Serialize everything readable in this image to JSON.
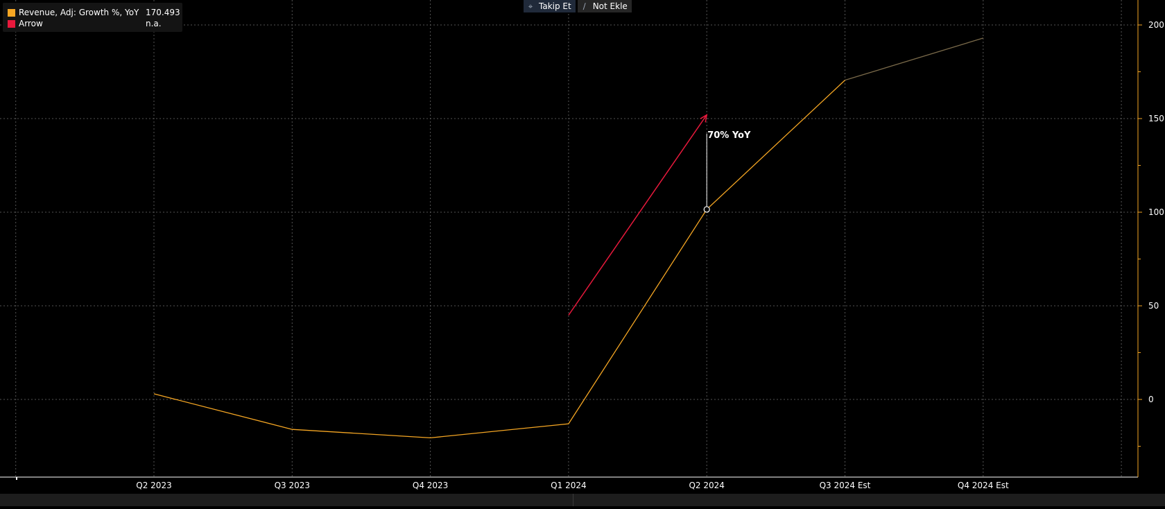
{
  "toolbar": {
    "follow_label": "Takip Et",
    "note_label": "Not Ekle",
    "follow_icon": "crosshair-icon",
    "note_icon": "pencil-icon"
  },
  "legend": {
    "items": [
      {
        "name": "Revenue, Adj: Growth %, YoY",
        "value": "170.493",
        "color": "#f5a623"
      },
      {
        "name": "Arrow",
        "value": "n.a.",
        "color": "#e8193c"
      }
    ]
  },
  "colors": {
    "background": "#000000",
    "series": "#f5a623",
    "series_estimate": "#7a6a4a",
    "arrow": "#e8193c",
    "axis": "#f5a623",
    "grid": "#555555"
  },
  "chart_data": {
    "type": "line",
    "title": "",
    "xlabel": "",
    "ylabel": "",
    "categories": [
      "Q2 2023",
      "Q3 2023",
      "Q4 2023",
      "Q1 2024",
      "Q2 2024",
      "Q3 2024 Est",
      "Q4 2024 Est"
    ],
    "series": [
      {
        "name": "Revenue, Adj: Growth %, YoY",
        "values": [
          3,
          -16,
          -20.5,
          -13,
          101.5,
          170.5,
          193
        ],
        "estimate_from_index": 5
      }
    ],
    "arrow": {
      "name": "Arrow",
      "from": {
        "x": "Q1 2024",
        "y": 45
      },
      "to": {
        "x": "Q2 2024",
        "y": 152
      }
    },
    "annotation": {
      "text": "70% YoY",
      "x": "Q2 2024",
      "y_from": 101.5,
      "y_to": 142
    },
    "y_ticks": [
      200,
      150,
      100,
      50,
      0
    ],
    "ylim": [
      -42,
      212
    ],
    "y_axis_position": "right",
    "grid": true,
    "legend_position": "top-left"
  }
}
